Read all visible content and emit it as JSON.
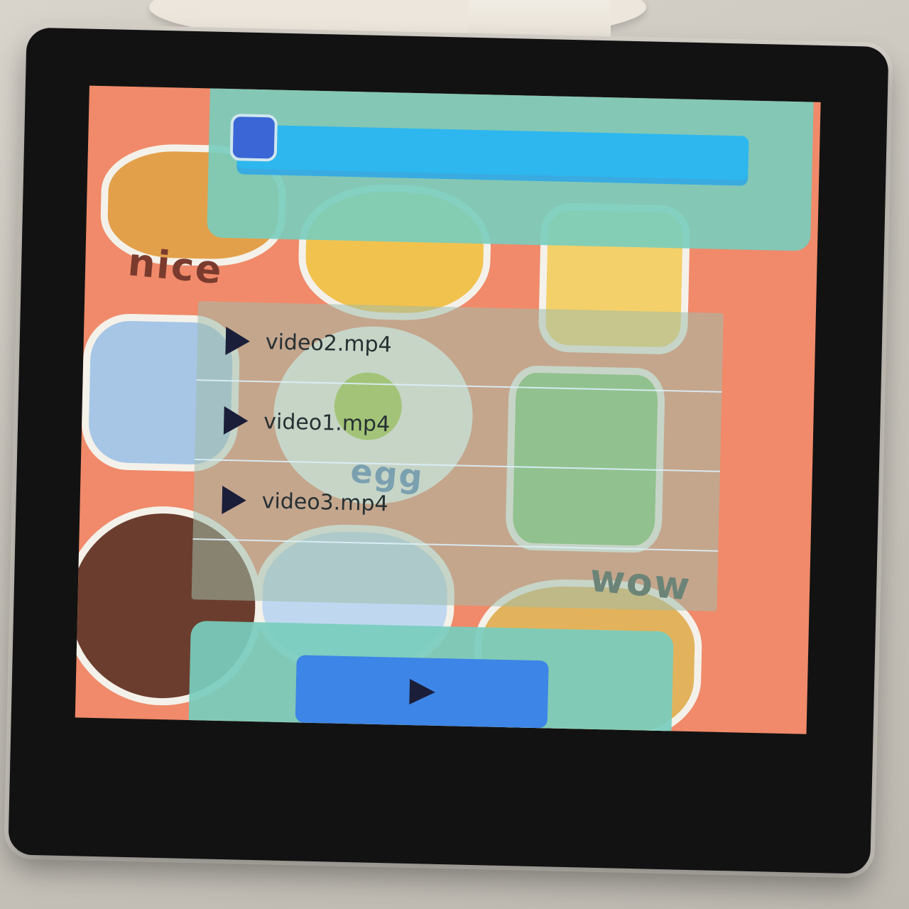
{
  "colors": {
    "panel": "#78cdbe",
    "progress_track": "#2db7ee",
    "progress_knob": "#3a66d6",
    "play_button": "#3d85e6",
    "wallpaper": "#f08a6a"
  },
  "wallpaper": {
    "words": [
      "nice",
      "egg",
      "wow"
    ]
  },
  "progress": {
    "value": 0.0
  },
  "playlist": {
    "items": [
      {
        "label": "video2.mp4",
        "icon": "play-icon"
      },
      {
        "label": "video1.mp4",
        "icon": "play-icon"
      },
      {
        "label": "video3.mp4",
        "icon": "play-icon"
      }
    ]
  },
  "controls": {
    "play_icon": "play-icon"
  }
}
